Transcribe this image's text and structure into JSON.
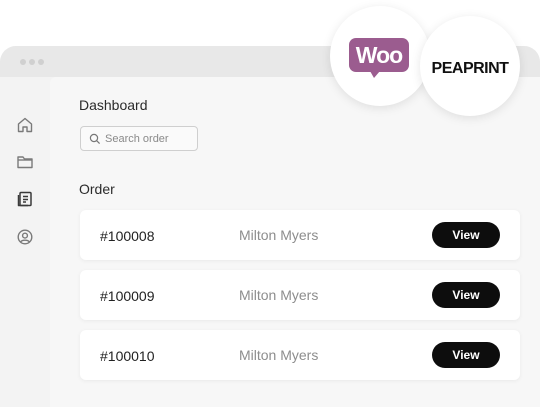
{
  "header": {
    "title": "Dashboard",
    "search": {
      "placeholder": "Search order",
      "value": ""
    }
  },
  "sidebar": {
    "items": [
      {
        "icon": "home-icon"
      },
      {
        "icon": "folder-icon"
      },
      {
        "icon": "orders-icon",
        "active": true
      },
      {
        "icon": "account-icon"
      }
    ]
  },
  "orders": {
    "section_title": "Order",
    "rows": [
      {
        "id": "#100008",
        "customer": "Milton Myers",
        "action": "View"
      },
      {
        "id": "#100009",
        "customer": "Milton Myers",
        "action": "View"
      },
      {
        "id": "#100010",
        "customer": "Milton Myers",
        "action": "View"
      }
    ]
  },
  "logos": {
    "woo": "Woo",
    "peaprint": "PEAPRINT"
  },
  "colors": {
    "woo_purple": "#9b5c8f",
    "button_bg": "#0d0d0d",
    "window_bg": "#f3f3f3"
  }
}
